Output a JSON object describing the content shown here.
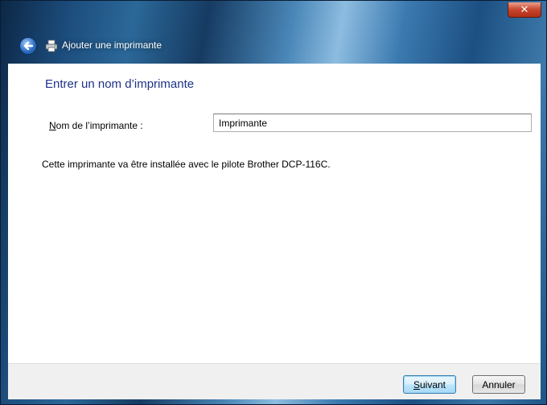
{
  "window": {
    "close_glyph": "✕",
    "title": "Ajouter une imprimante"
  },
  "icons": {
    "back": "back-arrow-icon",
    "printer": "printer-icon",
    "close": "close-icon"
  },
  "page": {
    "heading": "Entrer un nom d’imprimante",
    "name_label_mnemonic": "N",
    "name_label_rest": "om de l’imprimante :",
    "name_value": "Imprimante",
    "info": "Cette imprimante va être installée avec le pilote Brother DCP-116C."
  },
  "footer": {
    "next_mnemonic": "S",
    "next_rest": "uivant",
    "cancel": "Annuler"
  },
  "colors": {
    "heading": "#1e3287",
    "accent_button_border": "#3c7fb1"
  }
}
